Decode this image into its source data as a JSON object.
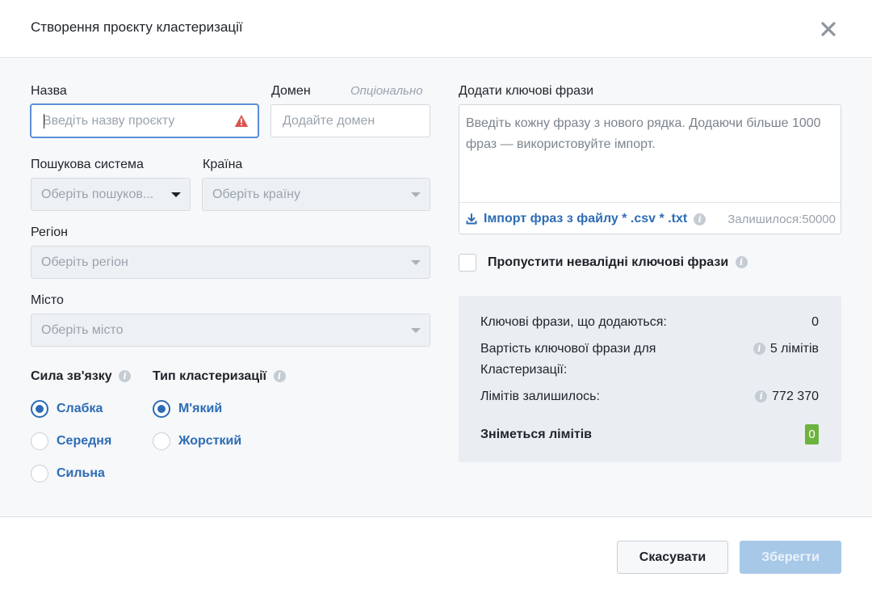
{
  "dialog": {
    "title": "Створення проєкту кластеризації"
  },
  "form": {
    "name": {
      "label": "Назва",
      "placeholder": "Введіть назву проєкту"
    },
    "domain": {
      "label": "Домен",
      "optional": "Опціонально",
      "placeholder": "Додайте домен"
    },
    "search_engine": {
      "label": "Пошукова система",
      "value": "Оберіть пошуков..."
    },
    "country": {
      "label": "Країна",
      "value": "Оберіть країну"
    },
    "region": {
      "label": "Регіон",
      "value": "Оберіть регіон"
    },
    "city": {
      "label": "Місто",
      "value": "Оберіть місто"
    },
    "link_strength": {
      "label": "Сила зв'язку",
      "options": [
        {
          "label": "Слабка",
          "checked": true
        },
        {
          "label": "Середня",
          "checked": false
        },
        {
          "label": "Сильна",
          "checked": false
        }
      ]
    },
    "clustering_type": {
      "label": "Тип кластеризації",
      "options": [
        {
          "label": "М'який",
          "checked": true
        },
        {
          "label": "Жорсткий",
          "checked": false
        }
      ]
    }
  },
  "keywords": {
    "label": "Додати ключові фрази",
    "placeholder": "Введіть кожну фразу з нового рядка. Додаючи більше 1000 фраз — використовуйте імпорт.",
    "import_label": "Імпорт фраз з файлу * .csv * .txt",
    "remaining": "Залишилося:50000",
    "skip_invalid": "Пропустити невалідні ключові фрази"
  },
  "summary": {
    "added_label": "Ключові фрази, що додаються:",
    "added_value": "0",
    "cost_label_1": "Вартість ключової фрази для",
    "cost_label_2": "Кластеризації:",
    "cost_value": "5 лімітів",
    "limits_left_label": "Лімітів залишилось:",
    "limits_left_value": "772 370",
    "deduct_label": "Зніметься лімітів",
    "deduct_value": "0"
  },
  "footer": {
    "cancel_label": "Скасувати",
    "save_label": "Зберегти"
  },
  "colors": {
    "accent": "#2d6cb5",
    "badge_green": "#6db33f",
    "warning_red": "#d9534f"
  },
  "icons": [
    "close-icon",
    "warning-icon",
    "download-icon",
    "info-icon",
    "chevron-down-icon"
  ]
}
